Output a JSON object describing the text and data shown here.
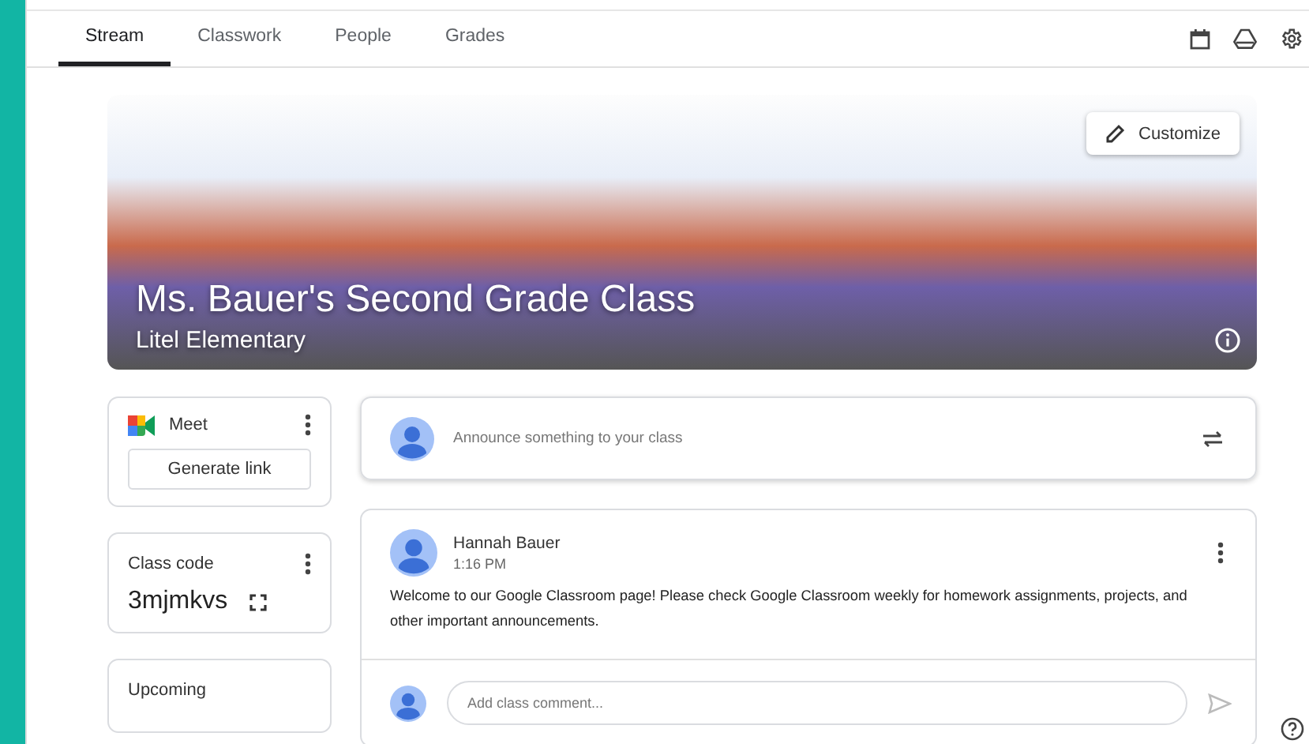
{
  "tabs": [
    {
      "label": "Stream",
      "selected": true
    },
    {
      "label": "Classwork",
      "selected": false
    },
    {
      "label": "People",
      "selected": false
    },
    {
      "label": "Grades",
      "selected": false
    }
  ],
  "banner": {
    "customize": "Customize",
    "title": "Ms. Bauer's Second Grade Class",
    "subtitle": "Litel Elementary"
  },
  "meet": {
    "title": "Meet",
    "button": "Generate link"
  },
  "class_code": {
    "label": "Class code",
    "code": "3mjmkvs"
  },
  "upcoming": {
    "title": "Upcoming"
  },
  "announce": {
    "placeholder": "Announce something to your class"
  },
  "post": {
    "author": "Hannah Bauer",
    "time": "1:16 PM",
    "text": "Welcome to our Google Classroom page! Please check Google Classroom weekly for homework assignments, projects, and other important announcements.",
    "comment_placeholder": "Add class comment..."
  }
}
